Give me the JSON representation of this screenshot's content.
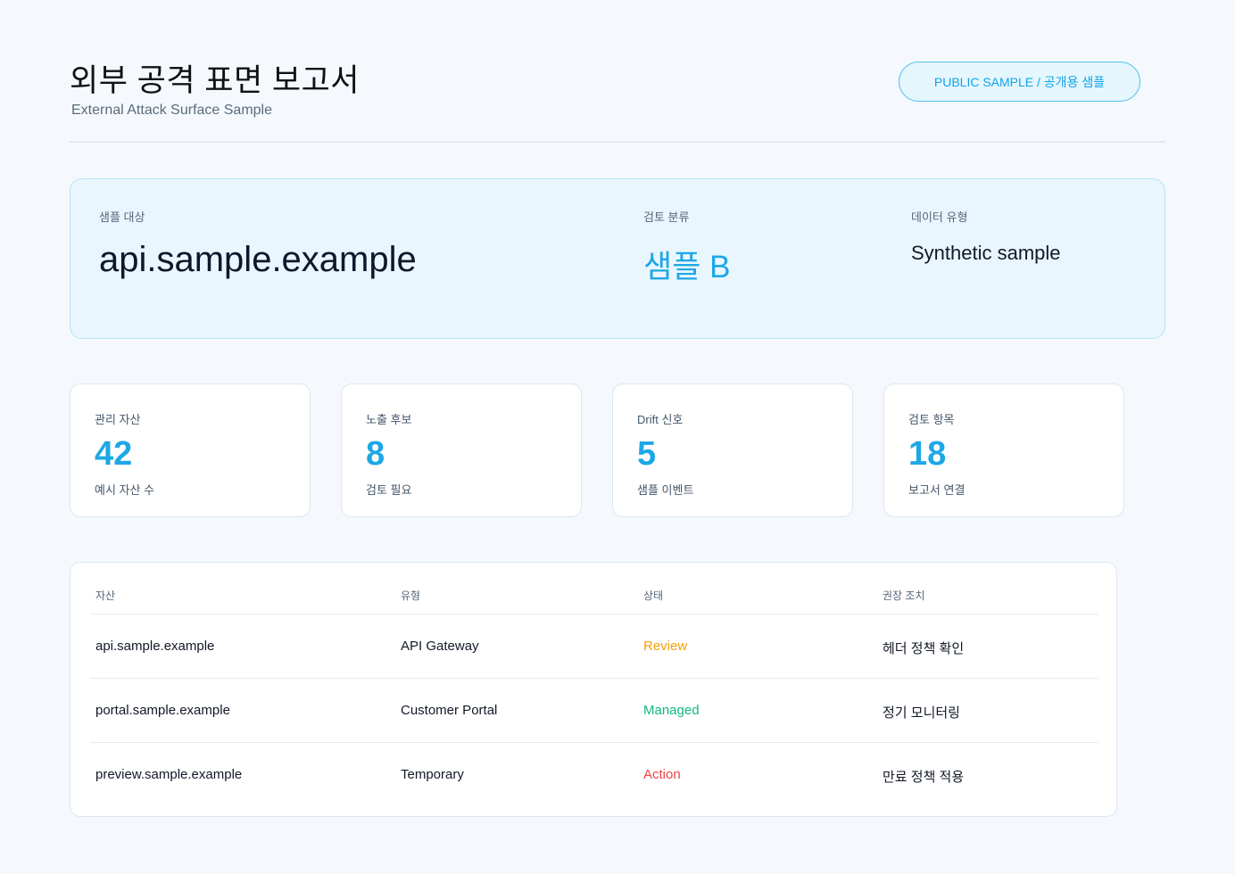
{
  "header": {
    "title": "외부 공격 표면 보고서",
    "subtitle": "External Attack Surface Sample",
    "badge": "PUBLIC SAMPLE / 공개용 샘플"
  },
  "hero": {
    "target_label": "샘플 대상",
    "target_value": "api.sample.example",
    "class_label": "검토 분류",
    "class_value": "샘플 B",
    "type_label": "데이터 유형",
    "type_value": "Synthetic sample"
  },
  "stats": [
    {
      "label": "관리 자산",
      "value": "42",
      "caption": "예시 자산 수"
    },
    {
      "label": "노출 후보",
      "value": "8",
      "caption": "검토 필요"
    },
    {
      "label": "Drift 신호",
      "value": "5",
      "caption": "샘플 이벤트"
    },
    {
      "label": "검토 항목",
      "value": "18",
      "caption": "보고서 연결"
    }
  ],
  "table": {
    "headers": [
      "자산",
      "유형",
      "상태",
      "권장 조치"
    ],
    "rows": [
      {
        "asset": "api.sample.example",
        "type": "API Gateway",
        "status": "Review",
        "action": "헤더 정책 확인"
      },
      {
        "asset": "portal.sample.example",
        "type": "Customer Portal",
        "status": "Managed",
        "action": "정기 모니터링"
      },
      {
        "asset": "preview.sample.example",
        "type": "Temporary",
        "status": "Action",
        "action": "만료 정책 적용"
      }
    ]
  },
  "colors": {
    "accent": "#1ea7e6",
    "status_review": "#f59e0b",
    "status_managed": "#10b981",
    "status_action": "#ef4444"
  }
}
